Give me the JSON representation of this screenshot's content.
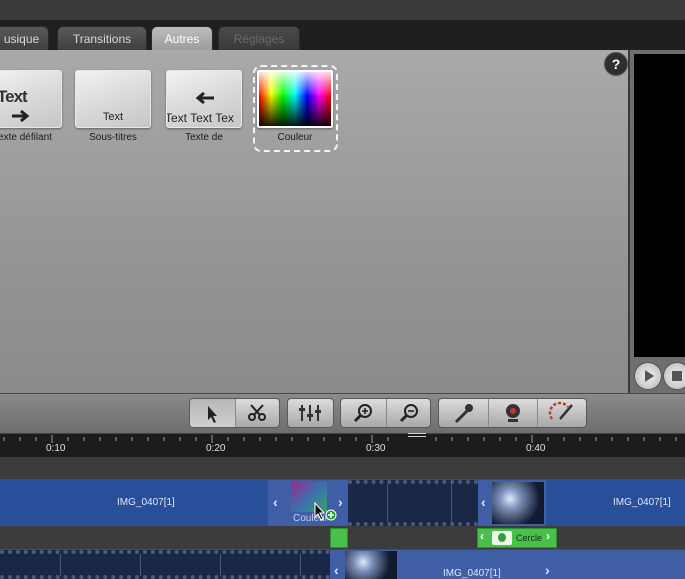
{
  "tabs": [
    {
      "label": "usique",
      "state": "normal"
    },
    {
      "label": "Transitions",
      "state": "normal"
    },
    {
      "label": "Autres",
      "state": "active"
    },
    {
      "label": "Réglages",
      "state": "disabled"
    }
  ],
  "library": {
    "help_label": "?",
    "items": [
      {
        "caption": "exte défilant",
        "thumb_text": "Text",
        "icon": "scroll-right-arrow-icon"
      },
      {
        "caption": "Sous-titres",
        "thumb_text": "Text",
        "icon": "subtitle-icon"
      },
      {
        "caption": "Texte de",
        "thumb_text": "Text Text Tex",
        "icon": "scroll-left-arrow-icon"
      },
      {
        "caption": "Couleur",
        "thumb_text": "",
        "icon": "color-gradient-icon",
        "selected": true
      }
    ]
  },
  "preview": {
    "play_icon": "play-icon",
    "stop_icon": "stop-icon"
  },
  "toolbar": {
    "tools": [
      "pointer-icon",
      "scissors-icon",
      "mixer-icon",
      "zoom-in-icon",
      "zoom-out-icon",
      "microphone-icon",
      "webcam-icon",
      "paint-brush-icon"
    ]
  },
  "ruler": {
    "ticks": [
      "0:10",
      "0:20",
      "0:30",
      "0:40"
    ]
  },
  "timeline": {
    "clip1_label": "IMG_0407[1]",
    "clip2_label": "IMG_0407[1]",
    "drag_label": "Couleur",
    "overlay_label": "Cercle",
    "bottom_label": "IMG_0407[1]"
  },
  "colors": {
    "track_blue": "#2a4f9a",
    "green_clip": "#48c04a"
  }
}
